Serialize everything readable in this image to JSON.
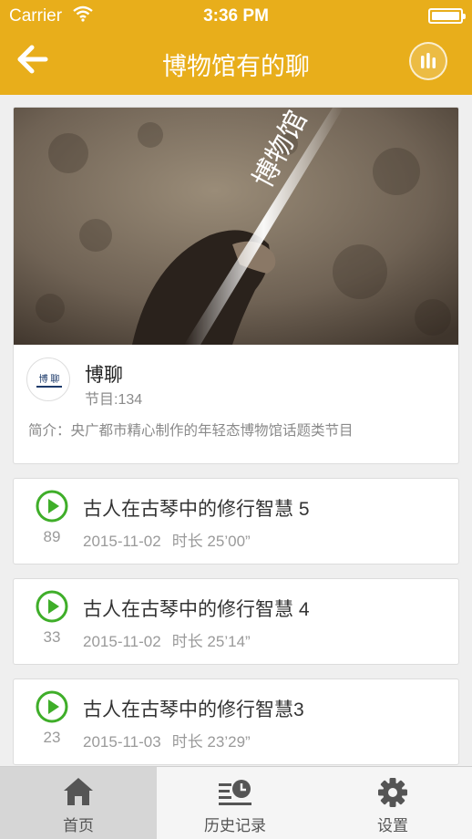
{
  "status_bar": {
    "carrier": "Carrier",
    "time": "3:36 PM"
  },
  "nav": {
    "title": "博物馆有的聊",
    "back_icon": "arrow-left-icon",
    "stats_icon": "bars-icon"
  },
  "channel": {
    "banner_text": "博物馆",
    "logo_text": "博 聊",
    "name": "博聊",
    "episodes": "节目:134",
    "intro": "简介：央广都市精心制作的年轻态博物馆话题类节目"
  },
  "episodes": [
    {
      "title": "古人在古琴中的修行智慧 5",
      "count": "89",
      "date": "2015-11-02",
      "duration": "时长 25’00”"
    },
    {
      "title": "古人在古琴中的修行智慧 4",
      "count": "33",
      "date": "2015-11-02",
      "duration": "时长 25’14”"
    },
    {
      "title": "古人在古琴中的修行智慧3",
      "count": "23",
      "date": "2015-11-03",
      "duration": "时长 23’29”"
    }
  ],
  "tabs": [
    {
      "label": "首页",
      "icon": "home-icon",
      "active": true
    },
    {
      "label": "历史记录",
      "icon": "history-icon",
      "active": false
    },
    {
      "label": "设置",
      "icon": "gear-icon",
      "active": false
    }
  ],
  "colors": {
    "header": "#e8ae1b",
    "play_green": "#3fae29",
    "background": "#efefef"
  }
}
